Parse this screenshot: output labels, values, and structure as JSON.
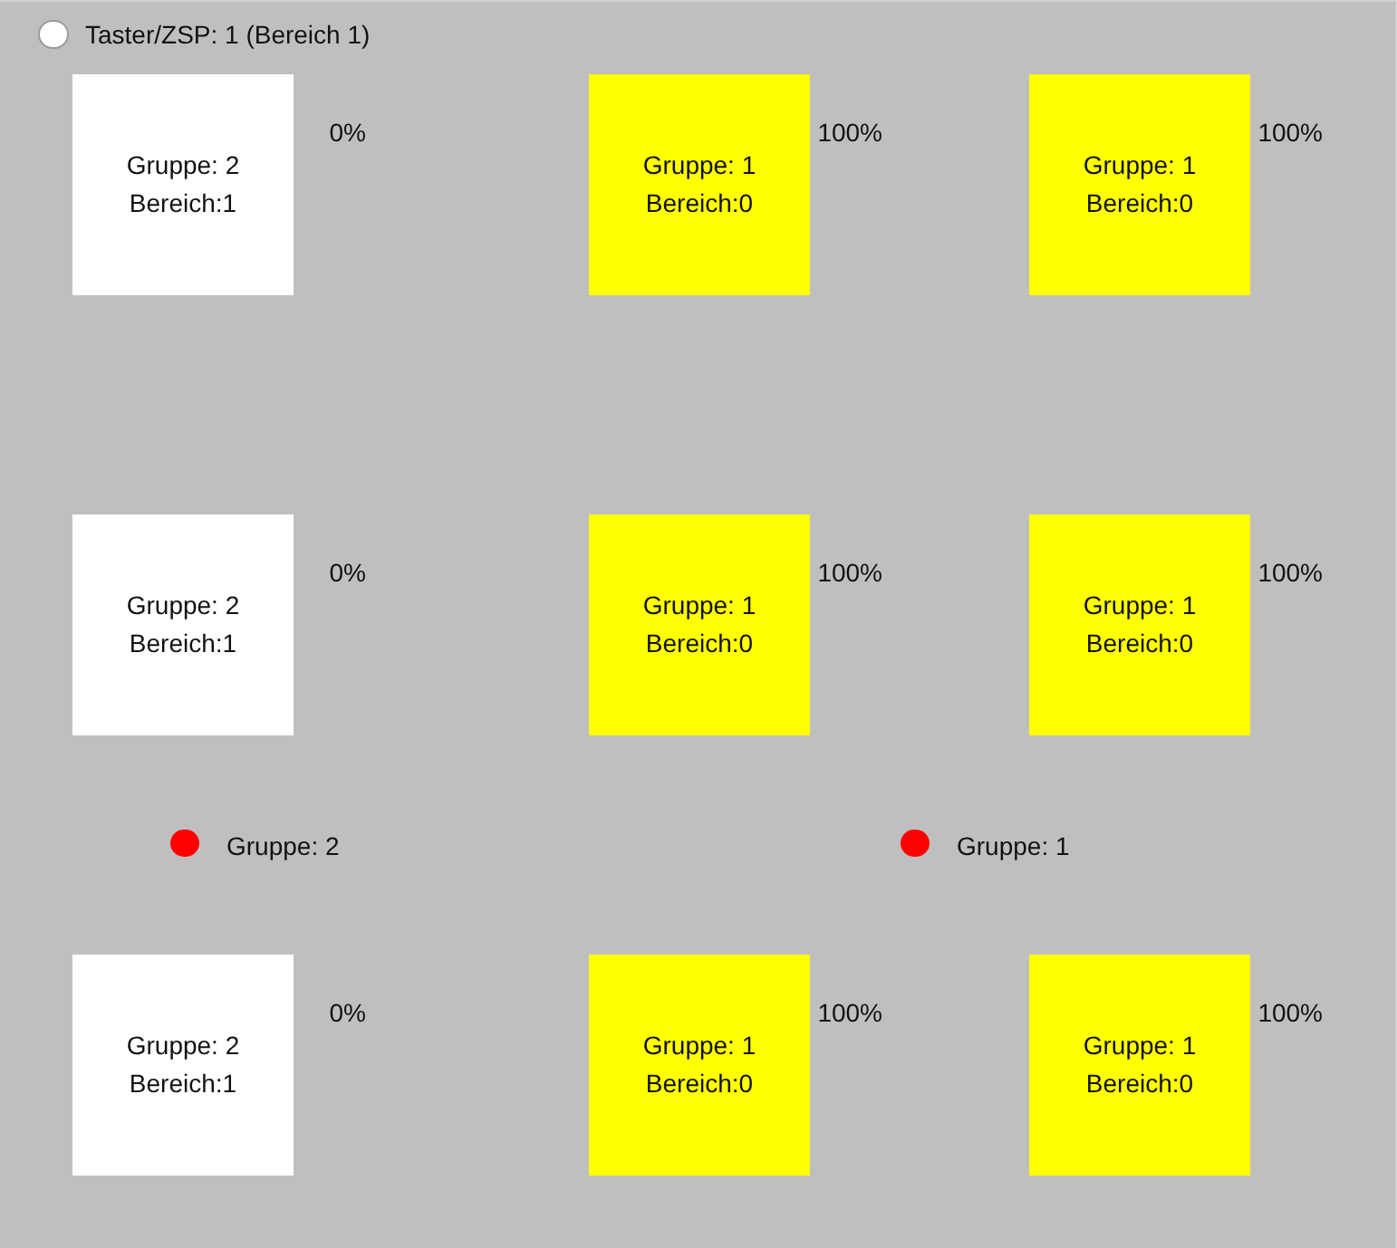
{
  "radio": {
    "label": "Taster/ZSP: 1 (Bereich 1)",
    "selected": false
  },
  "upper_rows": [
    {
      "tiles": [
        {
          "group": "Gruppe: 2",
          "area": "Bereich:1",
          "percent": "0%",
          "color": "#ffffff"
        },
        {
          "group": "Gruppe: 1",
          "area": "Bereich:0",
          "percent": "100%",
          "color": "#ffff00"
        },
        {
          "group": "Gruppe: 1",
          "area": "Bereich:0",
          "percent": "100%",
          "color": "#ffff00"
        }
      ]
    },
    {
      "tiles": [
        {
          "group": "Gruppe: 2",
          "area": "Bereich:1",
          "percent": "0%",
          "color": "#ffffff"
        },
        {
          "group": "Gruppe: 1",
          "area": "Bereich:0",
          "percent": "100%",
          "color": "#ffff00"
        },
        {
          "group": "Gruppe: 1",
          "area": "Bereich:0",
          "percent": "100%",
          "color": "#ffff00"
        }
      ]
    }
  ],
  "legend": [
    {
      "label": "Gruppe: 2",
      "color": "#ff0000"
    },
    {
      "label": "Gruppe: 1",
      "color": "#ff0000"
    }
  ],
  "lower_rows": [
    {
      "tiles": [
        {
          "group": "Gruppe: 2",
          "area": "Bereich:1",
          "percent": "0%",
          "color": "#ffffff"
        },
        {
          "group": "Gruppe: 1",
          "area": "Bereich:0",
          "percent": "100%",
          "color": "#ffff00"
        },
        {
          "group": "Gruppe: 1",
          "area": "Bereich:0",
          "percent": "100%",
          "color": "#ffff00"
        }
      ]
    }
  ]
}
